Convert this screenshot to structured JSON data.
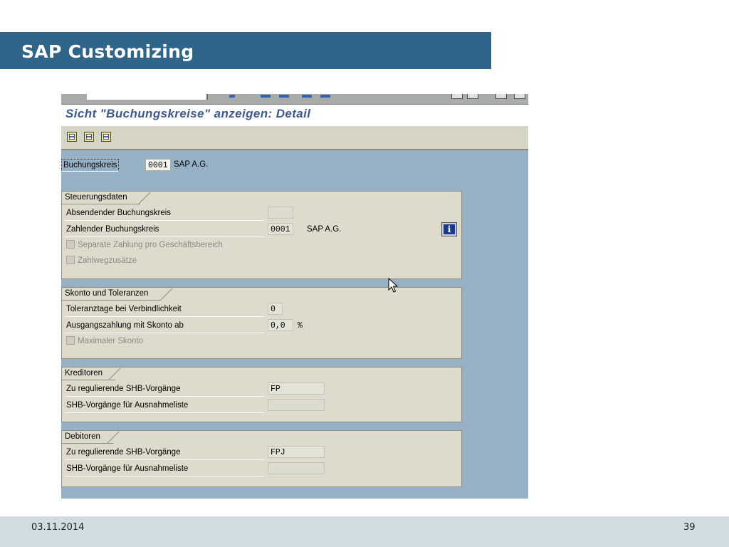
{
  "slide": {
    "title": "SAP Customizing",
    "date": "03.11.2014",
    "page_number": "39"
  },
  "sap": {
    "window_title": "Sicht \"Buchungskreise\" anzeigen: Detail",
    "toolbar": {
      "icons": [
        "previous-entry-icon",
        "next-entry-icon",
        "other-entry-icon"
      ]
    },
    "company_code": {
      "label": "Buchungskreis",
      "value": "0001",
      "name": "SAP A.G."
    },
    "groups": {
      "control": {
        "title": "Steuerungsdaten",
        "sending_label": "Absendender Buchungskreis",
        "sending_value": "",
        "paying_label": "Zahlender Buchungskreis",
        "paying_value": "0001",
        "paying_name": "SAP A.G.",
        "separate_payment_label": "Separate Zahlung pro Geschäftsbereich",
        "payment_method_label": "Zahlwegzusätze",
        "info_icon": "i"
      },
      "discount": {
        "title": "Skonto und Toleranzen",
        "tolerance_days_label": "Toleranztage bei Verbindlichkeit",
        "tolerance_days_value": "0",
        "outgoing_payment_label": "Ausgangszahlung mit Skonto ab",
        "outgoing_payment_value": "0,0",
        "outgoing_payment_unit": "%",
        "max_discount_label": "Maximaler Skonto"
      },
      "vendors": {
        "title": "Kreditoren",
        "shb_label": "Zu regulierende SHB-Vorgänge",
        "shb_value": "FP",
        "exception_label": "SHB-Vorgänge für Ausnahmeliste",
        "exception_value": ""
      },
      "customers": {
        "title": "Debitoren",
        "shb_label": "Zu regulierende SHB-Vorgänge",
        "shb_value": "FPJ",
        "exception_label": "SHB-Vorgänge für Ausnahmeliste",
        "exception_value": ""
      }
    }
  }
}
